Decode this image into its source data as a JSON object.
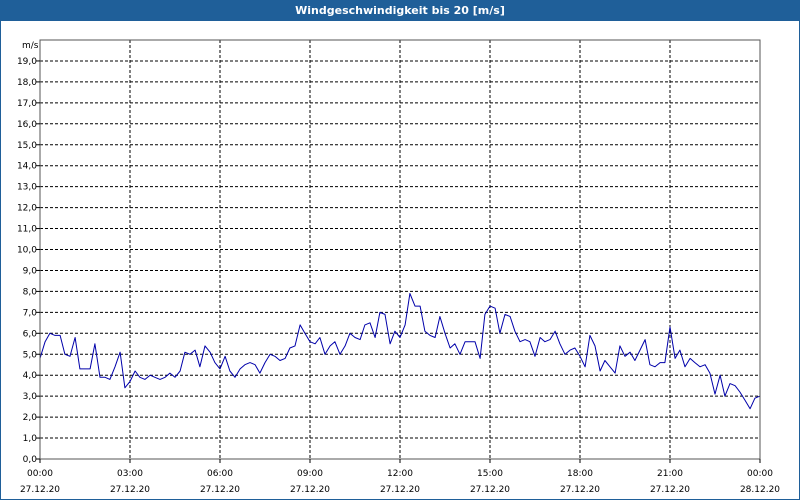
{
  "window": {
    "title": "Windgeschwindigkeit bis 20 [m/s]"
  },
  "chart_data": {
    "type": "line",
    "title": "Windgeschwindigkeit bis 20 [m/s]",
    "unit_label": "m/s",
    "ylim": [
      0,
      20
    ],
    "xlim_hours": [
      0,
      24
    ],
    "grid": true,
    "legend": "none",
    "line_color": "#0000aa",
    "y_ticks": [
      "0,0",
      "1,0",
      "2,0",
      "3,0",
      "4,0",
      "5,0",
      "6,0",
      "7,0",
      "8,0",
      "9,0",
      "10,0",
      "11,0",
      "12,0",
      "13,0",
      "14,0",
      "15,0",
      "16,0",
      "17,0",
      "18,0",
      "19,0"
    ],
    "x_ticks": [
      {
        "hour": 0,
        "time": "00:00",
        "date": "27.12.20"
      },
      {
        "hour": 3,
        "time": "03:00",
        "date": "27.12.20"
      },
      {
        "hour": 6,
        "time": "06:00",
        "date": "27.12.20"
      },
      {
        "hour": 9,
        "time": "09:00",
        "date": "27.12.20"
      },
      {
        "hour": 12,
        "time": "12:00",
        "date": "27.12.20"
      },
      {
        "hour": 15,
        "time": "15:00",
        "date": "27.12.20"
      },
      {
        "hour": 18,
        "time": "18:00",
        "date": "27.12.20"
      },
      {
        "hour": 21,
        "time": "21:00",
        "date": "27.12.20"
      },
      {
        "hour": 24,
        "time": "00:00",
        "date": "28.12.20"
      }
    ],
    "x_hours": [
      0,
      0.17,
      0.33,
      0.5,
      0.67,
      0.83,
      1,
      1.17,
      1.33,
      1.5,
      1.67,
      1.83,
      2,
      2.17,
      2.33,
      2.5,
      2.67,
      2.83,
      3,
      3.17,
      3.33,
      3.5,
      3.67,
      3.83,
      4,
      4.17,
      4.33,
      4.5,
      4.67,
      4.83,
      5,
      5.17,
      5.33,
      5.5,
      5.67,
      5.83,
      6,
      6.17,
      6.33,
      6.5,
      6.67,
      6.83,
      7,
      7.17,
      7.33,
      7.5,
      7.67,
      7.83,
      8,
      8.17,
      8.33,
      8.5,
      8.67,
      8.83,
      9,
      9.17,
      9.33,
      9.5,
      9.67,
      9.83,
      10,
      10.17,
      10.33,
      10.5,
      10.67,
      10.83,
      11,
      11.17,
      11.33,
      11.5,
      11.67,
      11.83,
      12,
      12.17,
      12.33,
      12.5,
      12.67,
      12.83,
      13,
      13.17,
      13.33,
      13.5,
      13.67,
      13.83,
      14,
      14.17,
      14.33,
      14.5,
      14.67,
      14.83,
      15,
      15.17,
      15.33,
      15.5,
      15.67,
      15.83,
      16,
      16.17,
      16.33,
      16.5,
      16.67,
      16.83,
      17,
      17.17,
      17.33,
      17.5,
      17.67,
      17.83,
      18,
      18.17,
      18.33,
      18.5,
      18.67,
      18.83,
      19,
      19.17,
      19.33,
      19.5,
      19.67,
      19.83,
      20,
      20.17,
      20.33,
      20.5,
      20.67,
      20.83,
      21,
      21.17,
      21.33,
      21.5,
      21.67,
      21.83,
      22,
      22.17,
      22.33,
      22.5,
      22.67,
      22.83,
      23,
      23.17,
      23.33,
      23.5,
      23.67,
      23.83,
      24
    ],
    "values": [
      4.8,
      5.6,
      6.0,
      5.9,
      5.9,
      5.0,
      4.9,
      5.8,
      4.3,
      4.3,
      4.3,
      5.5,
      3.9,
      3.9,
      3.8,
      4.4,
      5.1,
      3.4,
      3.7,
      4.2,
      3.9,
      3.8,
      4.0,
      3.9,
      3.8,
      3.9,
      4.1,
      3.9,
      4.2,
      5.1,
      5.0,
      5.2,
      4.4,
      5.4,
      5.1,
      4.6,
      4.3,
      4.9,
      4.2,
      3.9,
      4.3,
      4.5,
      4.6,
      4.5,
      4.1,
      4.6,
      5.0,
      4.9,
      4.7,
      4.8,
      5.3,
      5.4,
      6.4,
      6.0,
      5.6,
      5.5,
      5.8,
      5.0,
      5.4,
      5.6,
      5.0,
      5.4,
      6.0,
      5.8,
      5.7,
      6.4,
      6.5,
      5.8,
      7.0,
      6.9,
      5.5,
      6.1,
      5.8,
      6.4,
      7.9,
      7.3,
      7.3,
      6.1,
      5.9,
      5.8,
      6.8,
      6.0,
      5.3,
      5.5,
      5.0,
      5.6,
      5.6,
      5.6,
      4.8,
      6.9,
      7.3,
      7.2,
      6.0,
      6.9,
      6.8,
      6.1,
      5.6,
      5.7,
      5.6,
      4.9,
      5.8,
      5.6,
      5.7,
      6.1,
      5.5,
      5.0,
      5.2,
      5.3,
      4.9,
      4.4,
      5.9,
      5.4,
      4.2,
      4.7,
      4.4,
      4.1,
      5.4,
      4.9,
      5.1,
      4.7,
      5.2,
      5.7,
      4.5,
      4.4,
      4.6,
      4.6,
      6.3,
      4.8,
      5.2,
      4.4,
      4.8,
      4.6,
      4.4,
      4.5,
      4.1,
      3.1,
      4.0,
      3.0,
      3.6,
      3.5,
      3.2,
      2.8,
      2.4,
      2.9,
      3.0
    ]
  }
}
